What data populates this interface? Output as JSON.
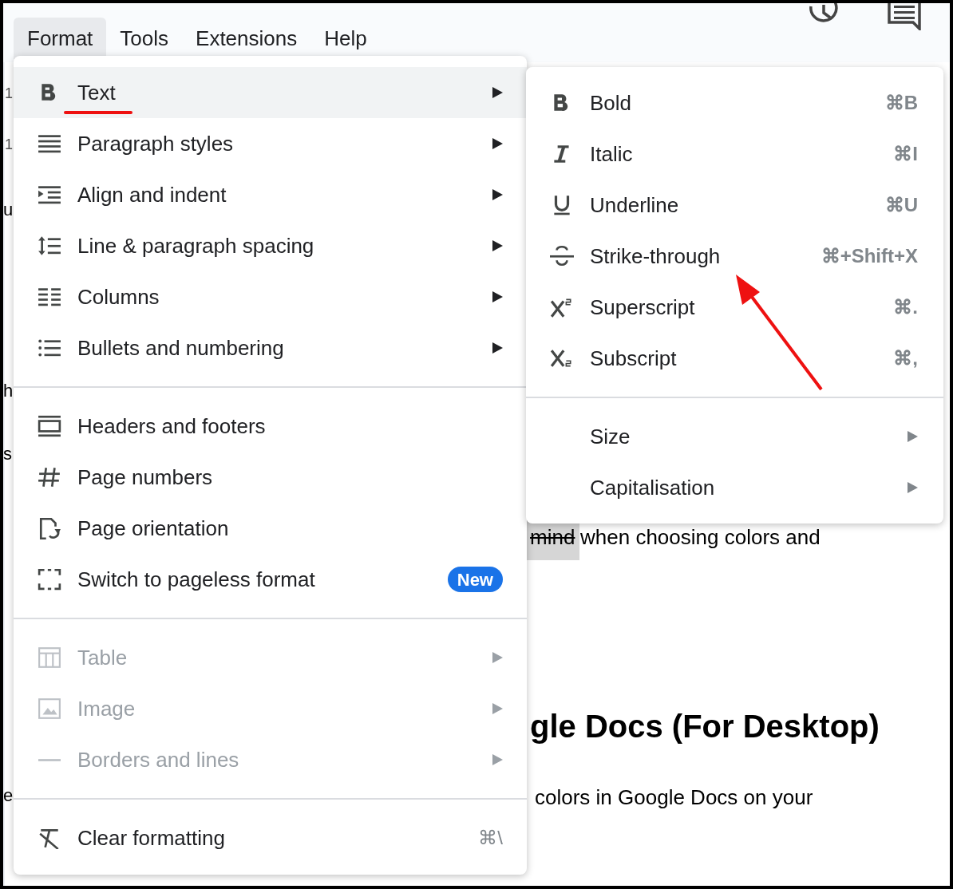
{
  "menu_bar": [
    {
      "label": "Format",
      "selected": true
    },
    {
      "label": "Tools",
      "selected": false
    },
    {
      "label": "Extensions",
      "selected": false
    },
    {
      "label": "Help",
      "selected": false
    }
  ],
  "document": {
    "ruler_marks": [
      "1",
      "1"
    ],
    "margin_letters": [
      "u",
      "h",
      "s",
      "e"
    ],
    "struck_word": "mind",
    "line_1": "when choosing colors and",
    "heading": "gle Docs (For Desktop)",
    "line_2": "colors in Google Docs on your"
  },
  "format_menu": [
    {
      "kind": "item",
      "label": "Text",
      "selected": true,
      "submenu": true,
      "disabled": false
    },
    {
      "kind": "item",
      "label": "Paragraph styles",
      "selected": false,
      "submenu": true,
      "disabled": false
    },
    {
      "kind": "item",
      "label": "Align and indent",
      "selected": false,
      "submenu": true,
      "disabled": false
    },
    {
      "kind": "item",
      "label": "Line & paragraph spacing",
      "selected": false,
      "submenu": true,
      "disabled": false
    },
    {
      "kind": "item",
      "label": "Columns",
      "selected": false,
      "submenu": true,
      "disabled": false
    },
    {
      "kind": "item",
      "label": "Bullets and numbering",
      "selected": false,
      "submenu": true,
      "disabled": false
    },
    {
      "kind": "divider"
    },
    {
      "kind": "item",
      "label": "Headers and footers",
      "selected": false,
      "submenu": false,
      "disabled": false
    },
    {
      "kind": "item",
      "label": "Page numbers",
      "selected": false,
      "submenu": false,
      "disabled": false
    },
    {
      "kind": "item",
      "label": "Page orientation",
      "selected": false,
      "submenu": false,
      "disabled": false
    },
    {
      "kind": "item",
      "label": "Switch to pageless format",
      "selected": false,
      "submenu": false,
      "disabled": false,
      "badge": "New"
    },
    {
      "kind": "divider"
    },
    {
      "kind": "item",
      "label": "Table",
      "selected": false,
      "submenu": true,
      "disabled": true
    },
    {
      "kind": "item",
      "label": "Image",
      "selected": false,
      "submenu": true,
      "disabled": true
    },
    {
      "kind": "item",
      "label": "Borders and lines",
      "selected": false,
      "submenu": true,
      "disabled": true
    },
    {
      "kind": "divider"
    },
    {
      "kind": "item",
      "label": "Clear formatting",
      "selected": false,
      "submenu": false,
      "disabled": false,
      "shortcut": "⌘\\"
    }
  ],
  "text_submenu": [
    {
      "kind": "item",
      "label": "Bold",
      "shortcut": "⌘B",
      "submenu": false
    },
    {
      "kind": "item",
      "label": "Italic",
      "shortcut": "⌘I",
      "submenu": false
    },
    {
      "kind": "item",
      "label": "Underline",
      "shortcut": "⌘U",
      "submenu": false
    },
    {
      "kind": "item",
      "label": "Strike-through",
      "shortcut": "⌘+Shift+X",
      "submenu": false
    },
    {
      "kind": "item",
      "label": "Superscript",
      "shortcut": "⌘.",
      "submenu": false
    },
    {
      "kind": "item",
      "label": "Subscript",
      "shortcut": "⌘,",
      "submenu": false
    },
    {
      "kind": "divider"
    },
    {
      "kind": "item",
      "label": "Size",
      "submenu": true
    },
    {
      "kind": "item",
      "label": "Capitalisation",
      "submenu": true
    }
  ]
}
